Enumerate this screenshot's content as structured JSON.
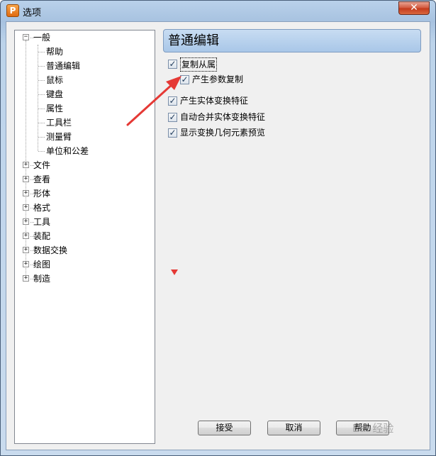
{
  "window": {
    "title": "选项",
    "app_icon_letter": "P",
    "close_glyph": "✕"
  },
  "tree": {
    "items": [
      {
        "label": "一般",
        "expander": "−",
        "children": [
          "帮助",
          "普通编辑",
          "鼠标",
          "键盘",
          "属性",
          "工具栏",
          "测量臂",
          "单位和公差"
        ],
        "selected_child": "普通编辑"
      },
      {
        "label": "文件",
        "expander": "+"
      },
      {
        "label": "查看",
        "expander": "+"
      },
      {
        "label": "形体",
        "expander": "+"
      },
      {
        "label": "格式",
        "expander": "+"
      },
      {
        "label": "工具",
        "expander": "+"
      },
      {
        "label": "装配",
        "expander": "+"
      },
      {
        "label": "数据交换",
        "expander": "+"
      },
      {
        "label": "绘图",
        "expander": "+"
      },
      {
        "label": "制造",
        "expander": "+"
      }
    ]
  },
  "content": {
    "title": "普通编辑",
    "options": [
      {
        "label": "复制从属",
        "checked": true
      },
      {
        "label": "产生参数复制",
        "checked": true
      },
      {
        "label": "产生实体变换特征",
        "checked": true
      },
      {
        "label": "自动合并实体变换特征",
        "checked": true
      },
      {
        "label": "显示变换几何元素预览",
        "checked": true
      }
    ]
  },
  "buttons": {
    "accept": "接受",
    "cancel": "取消",
    "help": "帮助"
  },
  "colors": {
    "annotation_red": "#e53935",
    "header_blue": "#a9c7e8"
  },
  "watermark_text": "Bai 经验"
}
